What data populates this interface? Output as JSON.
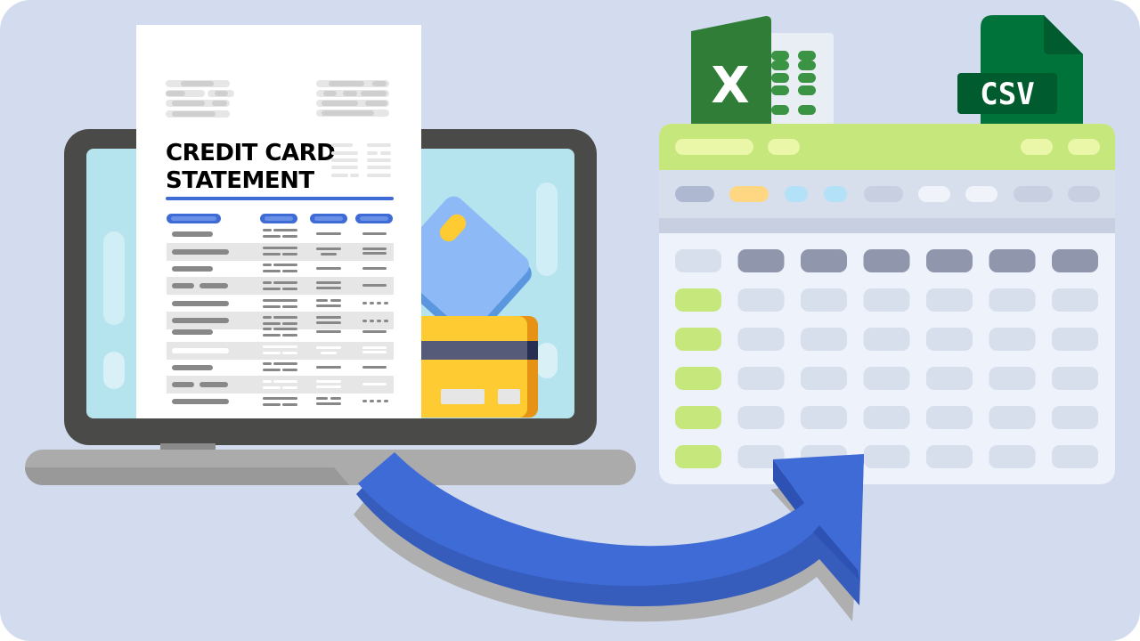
{
  "illustration": {
    "description": "Credit card statement on laptop being converted to Excel / CSV spreadsheet",
    "statement": {
      "title_line1": "CREDIT CARD",
      "title_line2": "STATEMENT"
    },
    "excel_icon": {
      "glyph": "X",
      "label": "excel-icon"
    },
    "csv_icon": {
      "label": "CSV"
    },
    "colors": {
      "background": "#D3DCEE",
      "laptop_frame": "#4A4A48",
      "laptop_screen": "#B5E3EE",
      "laptop_base": "#ABABAB",
      "laptop_base_shade": "#999999",
      "paper": "#FFFFFF",
      "statement_accent": "#3F6BD6",
      "statement_line": "#888888",
      "statement_row_shade": "#E6E6E6",
      "card_blue": "#8DB9F7",
      "card_blue_edge": "#5A97DE",
      "card_yellow": "#FECB32",
      "card_yellow_edge": "#E69214",
      "card_stripe": "#575B7A",
      "excel_green": "#2F7D36",
      "excel_cell_green": "#3A9443",
      "csv_green": "#00733B",
      "csv_dark": "#005C2E",
      "sheet_header": "#C5E77B",
      "sheet_header_pill": "#EAF6A8",
      "sheet_toolbar": "#D7DEEC",
      "sheet_body": "#EEF2FA",
      "sheet_header_cell": "#9096AB",
      "sheet_cell": "#D7DEEC",
      "sheet_row_label": "#C5E77B",
      "arrow_blue": "#3F6BD6",
      "arrow_shade": "#365DBB"
    },
    "toolbar_pills": [
      "#AFB8D1",
      "#FFD782",
      "#B3E1F7",
      "#B3E1F7",
      "#C7CFE1",
      "#F0F3FA",
      "#F0F3FA",
      "#C7CFE1",
      "#C7CFE1"
    ],
    "spreadsheet": {
      "header_columns": 6,
      "data_rows": 5
    }
  }
}
